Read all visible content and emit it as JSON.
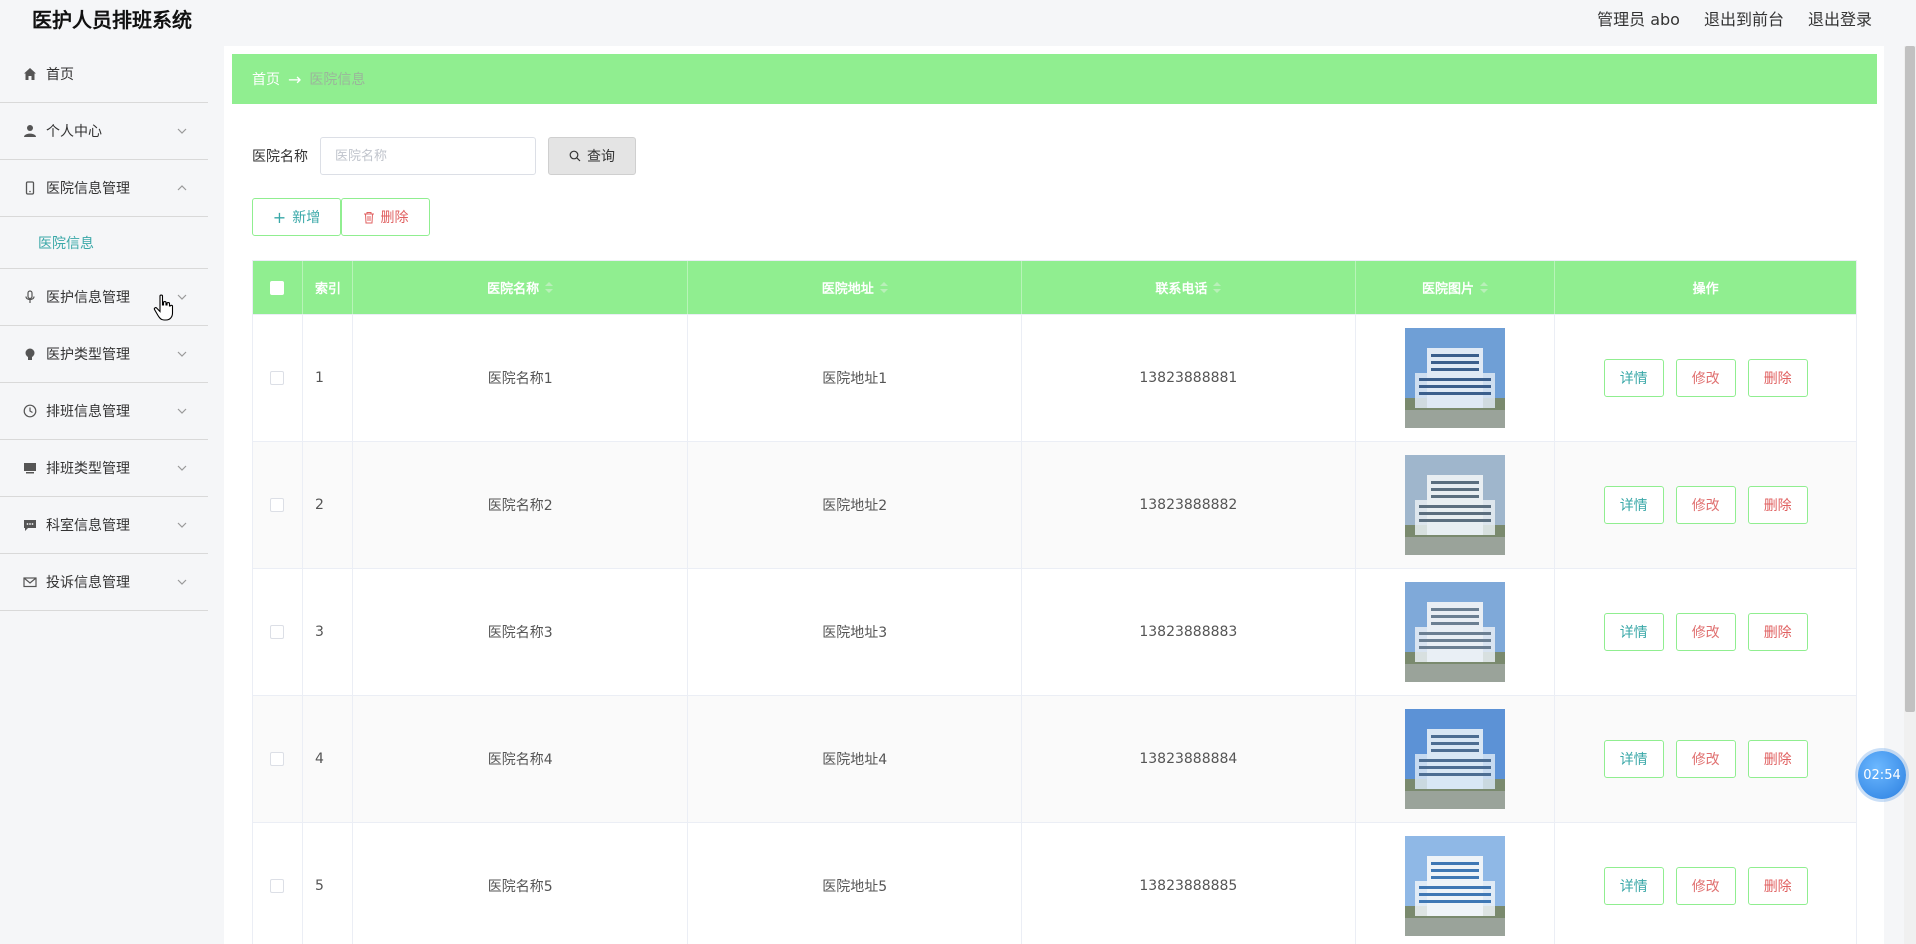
{
  "app": {
    "title": "医护人员排班系统",
    "user_label": "管理员 abo",
    "front_label": "退出到前台",
    "logout_label": "退出登录"
  },
  "sidebar": {
    "items": [
      {
        "label": "首页",
        "icon": "home-icon"
      },
      {
        "label": "个人中心",
        "icon": "user-icon"
      },
      {
        "label": "医院信息管理",
        "icon": "phone-icon",
        "expanded": true,
        "sub": "医院信息"
      },
      {
        "label": "医护信息管理",
        "icon": "microphone-icon"
      },
      {
        "label": "医护类型管理",
        "icon": "bulb-icon"
      },
      {
        "label": "排班信息管理",
        "icon": "clock-icon"
      },
      {
        "label": "排班类型管理",
        "icon": "monitor-icon"
      },
      {
        "label": "科室信息管理",
        "icon": "chat-icon"
      },
      {
        "label": "投诉信息管理",
        "icon": "mail-icon"
      }
    ]
  },
  "breadcrumb": {
    "home": "首页",
    "separator": "→",
    "current": "医院信息"
  },
  "search": {
    "label": "医院名称",
    "placeholder": "医院名称",
    "button": "查询"
  },
  "actions": {
    "add": "新增",
    "delete": "删除"
  },
  "table": {
    "headers": {
      "index": "索引",
      "name": "医院名称",
      "address": "医院地址",
      "phone": "联系电话",
      "image": "医院图片",
      "ops": "操作"
    },
    "rows": [
      {
        "index": "1",
        "name": "医院名称1",
        "address": "医院地址1",
        "phone": "13823888881"
      },
      {
        "index": "2",
        "name": "医院名称2",
        "address": "医院地址2",
        "phone": "13823888882"
      },
      {
        "index": "3",
        "name": "医院名称3",
        "address": "医院地址3",
        "phone": "13823888883"
      },
      {
        "index": "4",
        "name": "医院名称4",
        "address": "医院地址4",
        "phone": "13823888884"
      },
      {
        "index": "5",
        "name": "医院名称5",
        "address": "医院地址5",
        "phone": "13823888885"
      }
    ],
    "ops": {
      "detail": "详情",
      "edit": "修改",
      "delete": "删除"
    }
  },
  "timer": "02:54",
  "colors": {
    "accent_green": "#90ee90",
    "teal_text": "#3aa8a8",
    "danger_text": "#e06060"
  }
}
